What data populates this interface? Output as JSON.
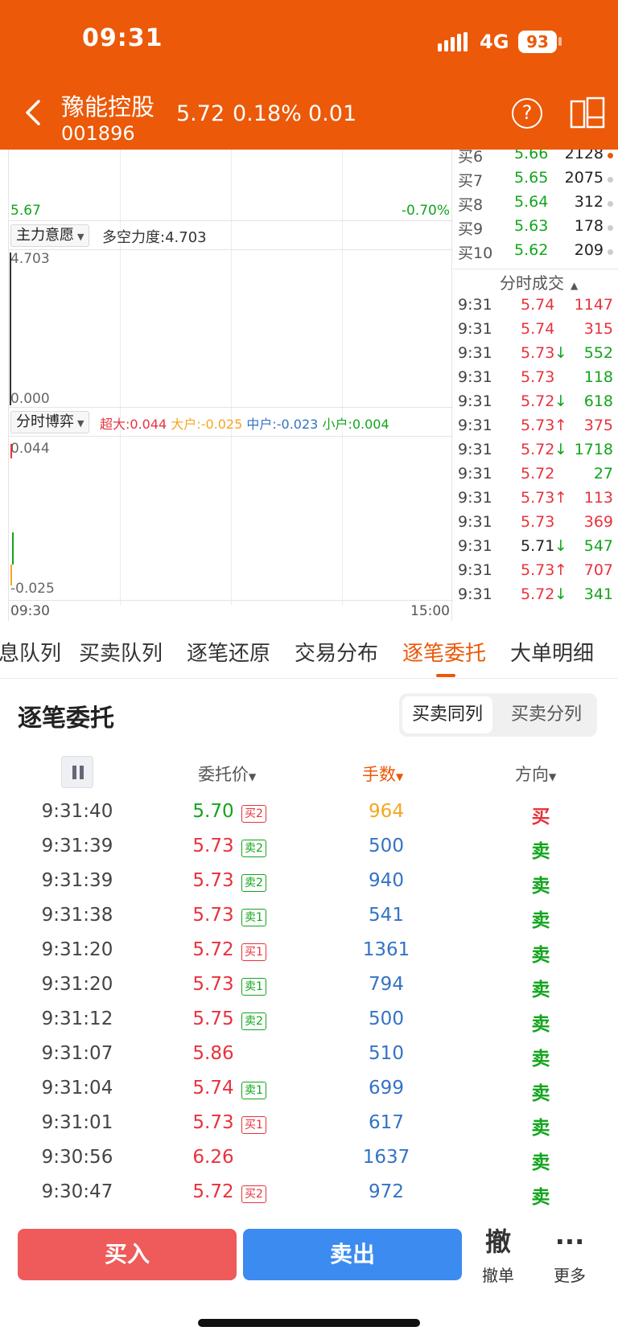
{
  "colors": {
    "brand": "#eb5909",
    "up": "#e8323c",
    "down": "#12a51c",
    "blue": "#3473c4",
    "orange": "#f5a623"
  },
  "status": {
    "time": "09:31",
    "network": "4G",
    "battery": "93"
  },
  "header": {
    "name": "豫能控股",
    "code": "001896",
    "price": "5.72",
    "pct": "0.18%",
    "change": "0.01",
    "help": "?"
  },
  "chart": {
    "top_left_price": "5.67",
    "top_right_pct": "-0.70%",
    "panel2": {
      "selector": "主力意愿",
      "label": "多空力度:4.703",
      "max": "4.703",
      "min": "0.000"
    },
    "panel3": {
      "selector": "分时博弈",
      "legend": [
        {
          "text": "超大:0.044",
          "color": "#e8323c"
        },
        {
          "text": "大户:-0.025",
          "color": "#f5a623"
        },
        {
          "text": "中户:-0.023",
          "color": "#3473c4"
        },
        {
          "text": "小户:0.004",
          "color": "#12a51c"
        }
      ],
      "max": "0.044",
      "min": "-0.025"
    },
    "time_start": "09:30",
    "time_end": "15:00"
  },
  "order_book": [
    {
      "label": "买6",
      "price": "5.66",
      "vol": "2128",
      "dot": "#eb5909"
    },
    {
      "label": "买7",
      "price": "5.65",
      "vol": "2075",
      "dot": "#cccccc"
    },
    {
      "label": "买8",
      "price": "5.64",
      "vol": "312",
      "dot": "#cccccc"
    },
    {
      "label": "买9",
      "price": "5.63",
      "vol": "178",
      "dot": "#cccccc"
    },
    {
      "label": "买10",
      "price": "5.62",
      "vol": "209",
      "dot": "#cccccc"
    }
  ],
  "trades_header": "分时成交",
  "trades": [
    {
      "time": "9:31",
      "price": "5.74",
      "arrow": "",
      "vol": "1147",
      "pc": "#e8323c",
      "vc": "#e8323c"
    },
    {
      "time": "9:31",
      "price": "5.74",
      "arrow": "",
      "vol": "315",
      "pc": "#e8323c",
      "vc": "#e8323c"
    },
    {
      "time": "9:31",
      "price": "5.73",
      "arrow": "↓",
      "vol": "552",
      "pc": "#e8323c",
      "vc": "#12a51c"
    },
    {
      "time": "9:31",
      "price": "5.73",
      "arrow": "",
      "vol": "118",
      "pc": "#e8323c",
      "vc": "#12a51c"
    },
    {
      "time": "9:31",
      "price": "5.72",
      "arrow": "↓",
      "vol": "618",
      "pc": "#e8323c",
      "vc": "#12a51c"
    },
    {
      "time": "9:31",
      "price": "5.73",
      "arrow": "↑",
      "vol": "375",
      "pc": "#e8323c",
      "vc": "#e8323c"
    },
    {
      "time": "9:31",
      "price": "5.72",
      "arrow": "↓",
      "vol": "1718",
      "pc": "#e8323c",
      "vc": "#12a51c"
    },
    {
      "time": "9:31",
      "price": "5.72",
      "arrow": "",
      "vol": "27",
      "pc": "#e8323c",
      "vc": "#12a51c"
    },
    {
      "time": "9:31",
      "price": "5.73",
      "arrow": "↑",
      "vol": "113",
      "pc": "#e8323c",
      "vc": "#e8323c"
    },
    {
      "time": "9:31",
      "price": "5.73",
      "arrow": "",
      "vol": "369",
      "pc": "#e8323c",
      "vc": "#e8323c"
    },
    {
      "time": "9:31",
      "price": "5.71",
      "arrow": "↓",
      "vol": "547",
      "pc": "#222222",
      "vc": "#12a51c"
    },
    {
      "time": "9:31",
      "price": "5.73",
      "arrow": "↑",
      "vol": "707",
      "pc": "#e8323c",
      "vc": "#e8323c"
    },
    {
      "time": "9:31",
      "price": "5.72",
      "arrow": "↓",
      "vol": "341",
      "pc": "#e8323c",
      "vc": "#12a51c"
    }
  ],
  "tabs": [
    "息队列",
    "买卖队列",
    "逐笔还原",
    "交易分布",
    "逐笔委托",
    "大单明细"
  ],
  "active_tab": 4,
  "section": {
    "title": "逐笔委托",
    "seg_on": "买卖同列",
    "seg_off": "买卖分列"
  },
  "columns": {
    "price": "委托价",
    "volume": "手数",
    "direction": "方向"
  },
  "entries": [
    {
      "time": "9:31:40",
      "price": "5.70",
      "pc": "#12a51c",
      "badge": "买2",
      "bc": "#e8323c",
      "vol": "964",
      "vcol": "#f5a623",
      "dir": "买",
      "dc": "#e8323c"
    },
    {
      "time": "9:31:39",
      "price": "5.73",
      "pc": "#e8323c",
      "badge": "卖2",
      "bc": "#12a51c",
      "vol": "500",
      "vcol": "#3473c4",
      "dir": "卖",
      "dc": "#12a51c"
    },
    {
      "time": "9:31:39",
      "price": "5.73",
      "pc": "#e8323c",
      "badge": "卖2",
      "bc": "#12a51c",
      "vol": "940",
      "vcol": "#3473c4",
      "dir": "卖",
      "dc": "#12a51c"
    },
    {
      "time": "9:31:38",
      "price": "5.73",
      "pc": "#e8323c",
      "badge": "卖1",
      "bc": "#12a51c",
      "vol": "541",
      "vcol": "#3473c4",
      "dir": "卖",
      "dc": "#12a51c"
    },
    {
      "time": "9:31:20",
      "price": "5.72",
      "pc": "#e8323c",
      "badge": "买1",
      "bc": "#e8323c",
      "vol": "1361",
      "vcol": "#3473c4",
      "dir": "卖",
      "dc": "#12a51c"
    },
    {
      "time": "9:31:20",
      "price": "5.73",
      "pc": "#e8323c",
      "badge": "卖1",
      "bc": "#12a51c",
      "vol": "794",
      "vcol": "#3473c4",
      "dir": "卖",
      "dc": "#12a51c"
    },
    {
      "time": "9:31:12",
      "price": "5.75",
      "pc": "#e8323c",
      "badge": "卖2",
      "bc": "#12a51c",
      "vol": "500",
      "vcol": "#3473c4",
      "dir": "卖",
      "dc": "#12a51c"
    },
    {
      "time": "9:31:07",
      "price": "5.86",
      "pc": "#e8323c",
      "badge": "",
      "bc": "#12a51c",
      "vol": "510",
      "vcol": "#3473c4",
      "dir": "卖",
      "dc": "#12a51c"
    },
    {
      "time": "9:31:04",
      "price": "5.74",
      "pc": "#e8323c",
      "badge": "卖1",
      "bc": "#12a51c",
      "vol": "699",
      "vcol": "#3473c4",
      "dir": "卖",
      "dc": "#12a51c"
    },
    {
      "time": "9:31:01",
      "price": "5.73",
      "pc": "#e8323c",
      "badge": "买1",
      "bc": "#e8323c",
      "vol": "617",
      "vcol": "#3473c4",
      "dir": "卖",
      "dc": "#12a51c"
    },
    {
      "time": "9:30:56",
      "price": "6.26",
      "pc": "#e8323c",
      "badge": "",
      "bc": "#12a51c",
      "vol": "1637",
      "vcol": "#3473c4",
      "dir": "卖",
      "dc": "#12a51c"
    },
    {
      "time": "9:30:47",
      "price": "5.72",
      "pc": "#e8323c",
      "badge": "买2",
      "bc": "#e8323c",
      "vol": "972",
      "vcol": "#3473c4",
      "dir": "卖",
      "dc": "#12a51c"
    }
  ],
  "bottom": {
    "buy": "买入",
    "sell": "卖出",
    "cancel_icon": "撤",
    "cancel": "撤单",
    "more_icon": "···",
    "more": "更多"
  }
}
